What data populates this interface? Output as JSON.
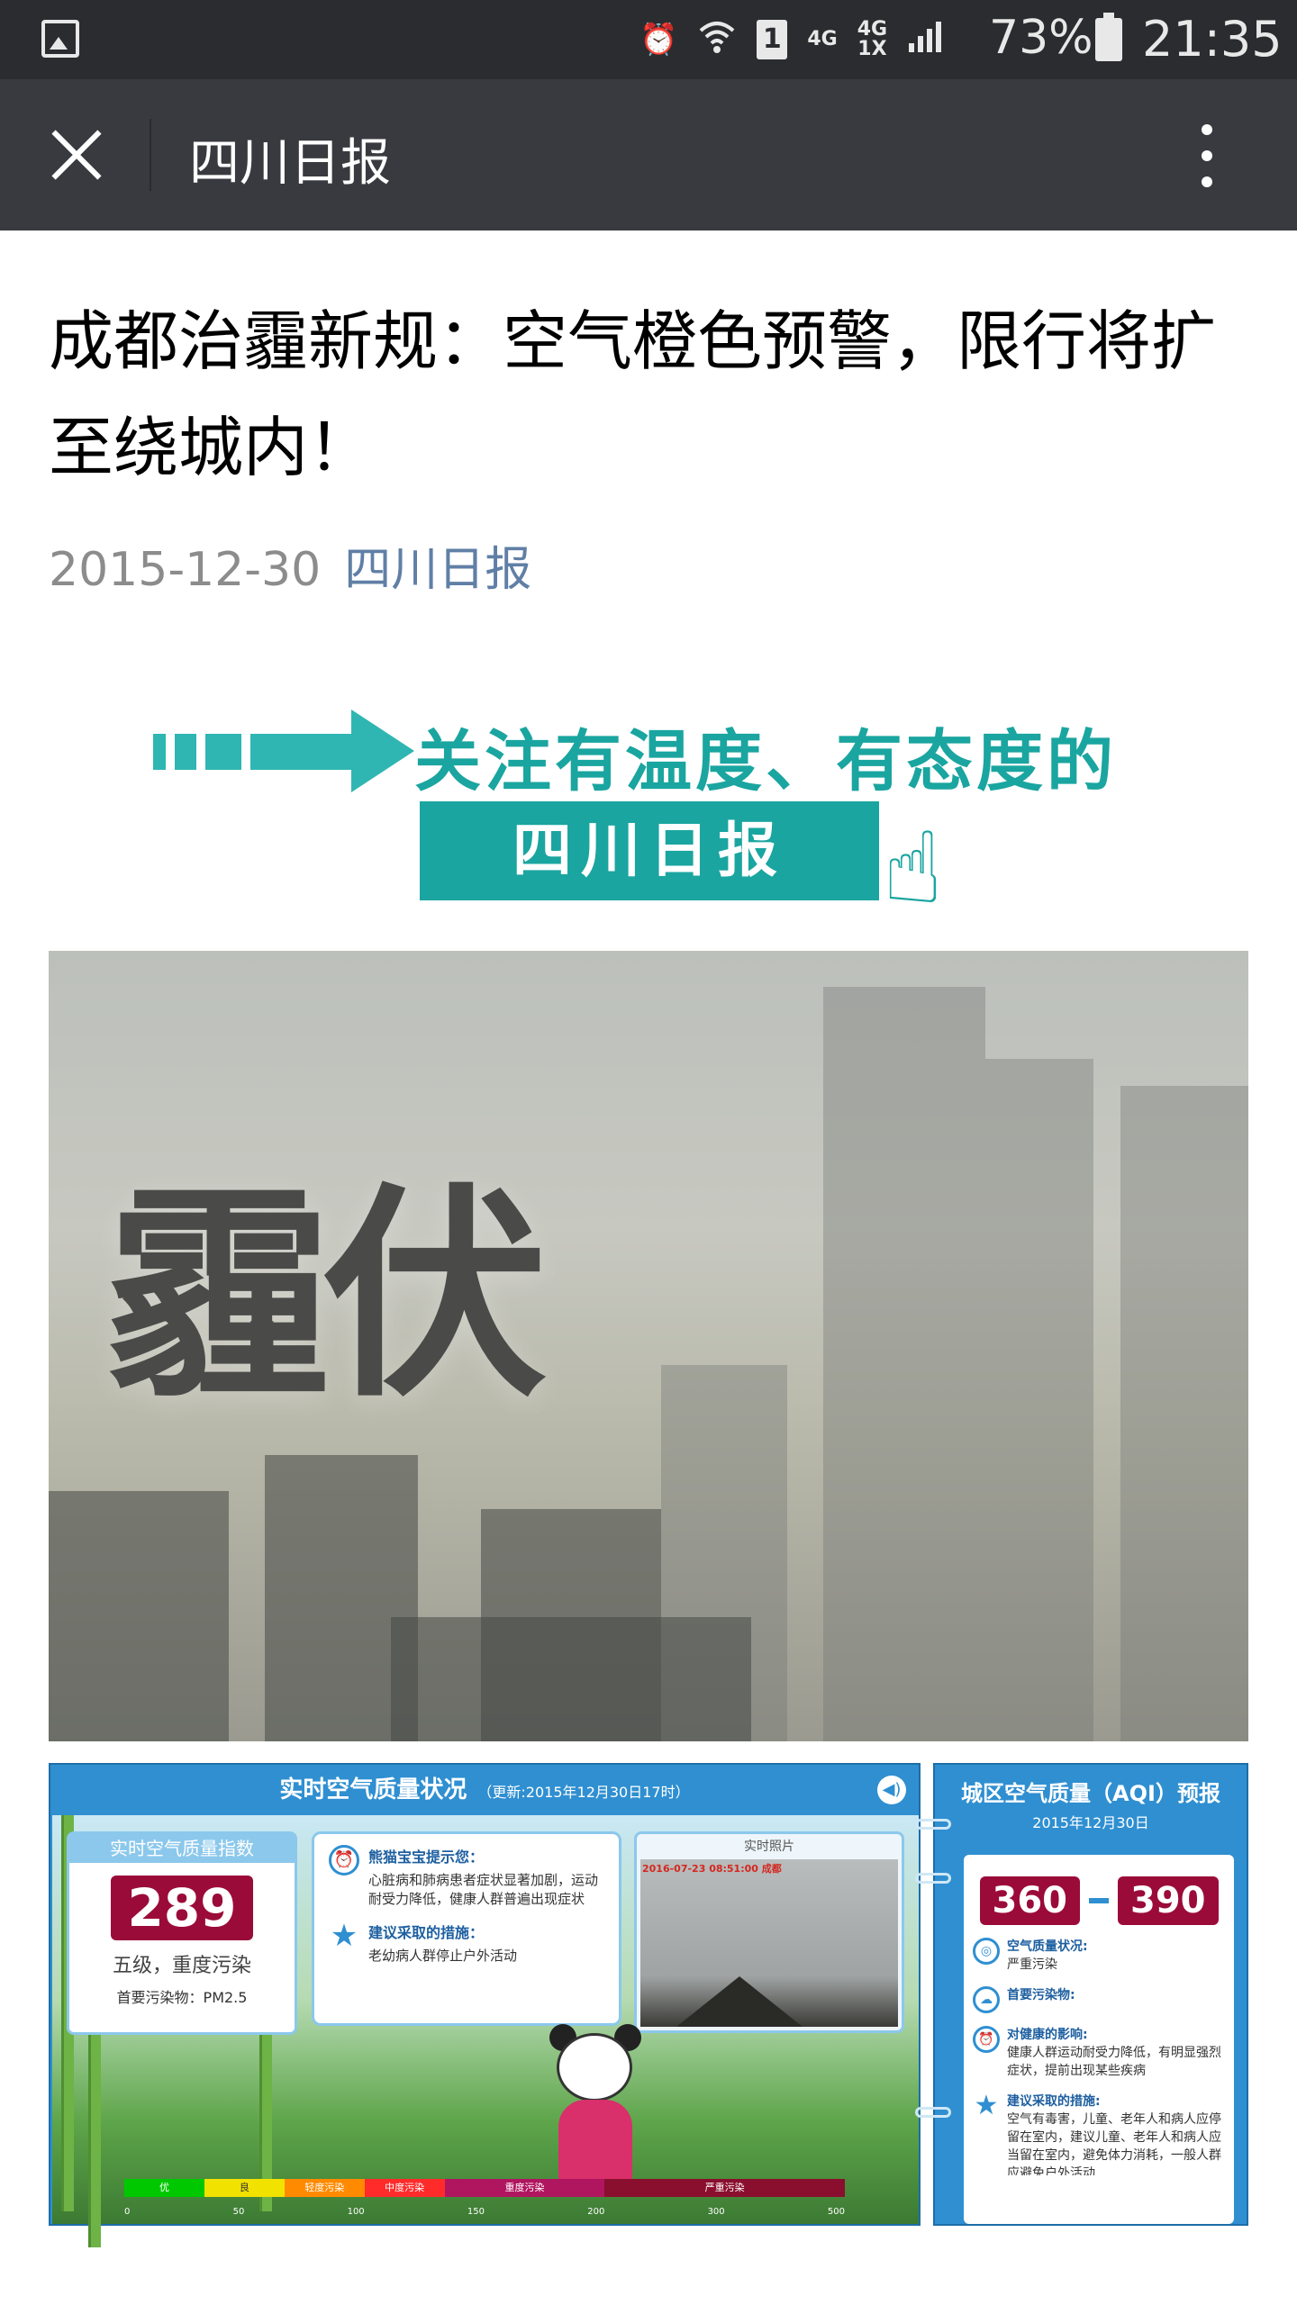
{
  "status_bar": {
    "icons": [
      "gallery-icon",
      "alarm-icon",
      "wifi-icon",
      "sim-1-icon",
      "signal-icon",
      "battery-icon"
    ],
    "sim": "1",
    "network_1": "4G",
    "network_2_top": "4G",
    "network_2_bottom": "1X",
    "battery": "73%",
    "time": "21:35"
  },
  "title_bar": {
    "title": "四川日报"
  },
  "article": {
    "title": "成都治霾新规：空气橙色预警，限行将扩至绕城内！",
    "date": "2015-12-30",
    "source": "四川日报"
  },
  "banner": {
    "slogan": "关注有温度、有态度的",
    "name": "四川日报"
  },
  "smog_image": {
    "headline": "霾伏"
  },
  "aqi_panel": {
    "title": "实时空气质量状况",
    "updated": "（更新:2015年12月30日17时）",
    "index_title": "实时空气质量指数",
    "index_value": "289",
    "level": "五级，重度污染",
    "primary_pollutant": "首要污染物：PM2.5",
    "tip_title": "熊猫宝宝提示您：",
    "tip_text": "心脏病和肺病患者症状显著加剧，运动耐受力降低，健康人群普遍出现症状",
    "measure_title": "建议采取的措施：",
    "measure_text": "老幼病人群停止户外活动",
    "photo_title": "实时照片",
    "photo_timestamp": "2016-07-23 08:51:00 成都",
    "scale_labels": [
      "优",
      "良",
      "轻度污染",
      "中度污染",
      "重度污染",
      "严重污染"
    ],
    "scale_ticks": [
      "0",
      "50",
      "100",
      "150",
      "200",
      "300",
      "500"
    ],
    "scale_colors": [
      "#00c800",
      "#f2e200",
      "#ff8a00",
      "#ff2a2a",
      "#b01560",
      "#8a0e2e"
    ]
  },
  "forecast_panel": {
    "title": "城区空气质量（AQI）预报",
    "date": "2015年12月30日",
    "low": "360",
    "high": "390",
    "status_title": "空气质量状况:",
    "status_text": "严重污染",
    "pollutant_title": "首要污染物:",
    "health_title": "对健康的影响:",
    "health_text": "健康人群运动耐受力降低，有明显强烈症状，提前出现某些疾病",
    "advice_title": "建议采取的措施:",
    "advice_text": "空气有毒害，儿童、老年人和病人应停留在室内，建议儿童、老年人和病人应当留在室内，避免体力消耗，一般人群应避免户外活动"
  },
  "colors": {
    "status_bar_bg": "#2b2c2f",
    "title_bar_bg": "#393a3f",
    "meta_gray": "#8c8c8c",
    "source_link": "#607fa6",
    "banner_teal": "#1aa5a0",
    "aqi_blue": "#2f8fd1",
    "aqi_value_bg": "#9b0b3a"
  }
}
